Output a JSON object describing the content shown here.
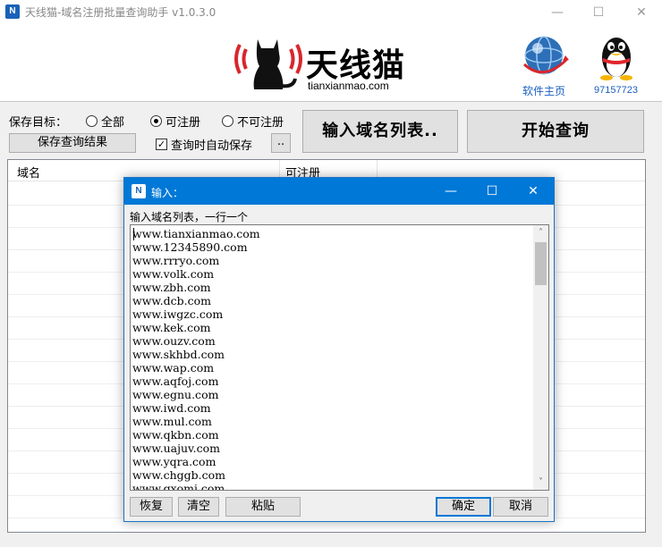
{
  "window": {
    "title": "天线猫-域名注册批量查询助手 v1.0.3.0",
    "minimize": "—",
    "maximize": "☐",
    "close": "✕"
  },
  "header": {
    "logo_cn": "天线猫",
    "logo_en": "tianxianmao.com",
    "home_label": "软件主页",
    "qq_number": "97157723"
  },
  "controls": {
    "save_target_label": "保存目标：",
    "radio_all": "全部",
    "radio_available": "可注册",
    "radio_unavailable": "不可注册",
    "selected_radio": "可注册",
    "save_results_button": "保存查询结果",
    "auto_save_checkbox": "查询时自动保存",
    "auto_save_checked": true,
    "browse_button": "..",
    "input_list_button": "输入域名列表..",
    "start_query_button": "开始查询"
  },
  "table": {
    "columns": [
      "域名",
      "可注册"
    ]
  },
  "dialog": {
    "title": "输入：",
    "prompt": "输入域名列表，一行一个",
    "lines": [
      "www.tianxianmao.com",
      "www.12345890.com",
      "www.rrryo.com",
      "www.volk.com",
      "www.zbh.com",
      "www.dcb.com",
      "www.iwgzc.com",
      "www.kek.com",
      "www.ouzv.com",
      "www.skhbd.com",
      "www.wap.com",
      "www.aqfoj.com",
      "www.egnu.com",
      "www.iwd.com",
      "www.mul.com",
      "www.qkbn.com",
      "www.uajuv.com",
      "www.yqra.com",
      "www.chggb.com",
      "www.gxomj.com"
    ],
    "restore_button": "恢复",
    "clear_button": "清空",
    "paste_button": "粘贴",
    "ok_button": "确定",
    "cancel_button": "取消",
    "minimize": "—",
    "maximize": "☐",
    "close": "✕",
    "scroll_up": "˄",
    "scroll_down": "˅"
  }
}
